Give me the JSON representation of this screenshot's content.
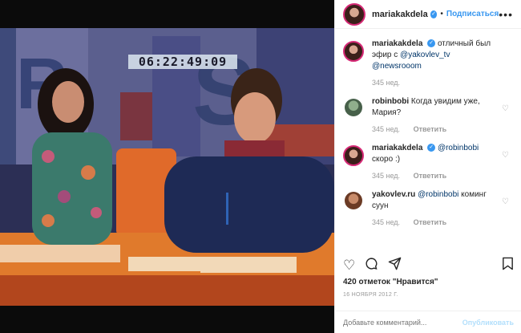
{
  "photo": {
    "clock": "06:22:49:09",
    "description_alt": "news studio"
  },
  "header": {
    "username": "mariakakdela",
    "follow_label": "Подписаться",
    "more_icon": "more-horizontal-icon"
  },
  "comments": [
    {
      "user": "mariakakdela",
      "text": "отличный был эфир с",
      "mentions": [
        "@yakovlev_tv",
        "@newsrooom"
      ],
      "time": "345 нед.",
      "reply": ""
    },
    {
      "user": "robinbobi",
      "text": "Когда увидим уже, Мария?",
      "mentions": [],
      "time": "345 нед.",
      "reply": "Ответить"
    },
    {
      "user": "mariakakdela",
      "text": "скоро :)",
      "mentions": [
        "@robinbobi"
      ],
      "time": "345 нед.",
      "reply": "Ответить"
    },
    {
      "user": "yakovlev.ru",
      "text": "коминг суун",
      "mentions": [
        "@robinbobi"
      ],
      "time": "345 нед.",
      "reply": "Ответить"
    }
  ],
  "footer": {
    "likes": "420 отметок \"Нравится\"",
    "date": "16 НОЯБРЯ 2012 Г.",
    "comment_placeholder": "Добавьте комментарий...",
    "publish_label": "Опубликовать"
  },
  "colors": {
    "accent": "#3897f0",
    "verified": "#3897f0",
    "story_ring": "#d62976"
  }
}
